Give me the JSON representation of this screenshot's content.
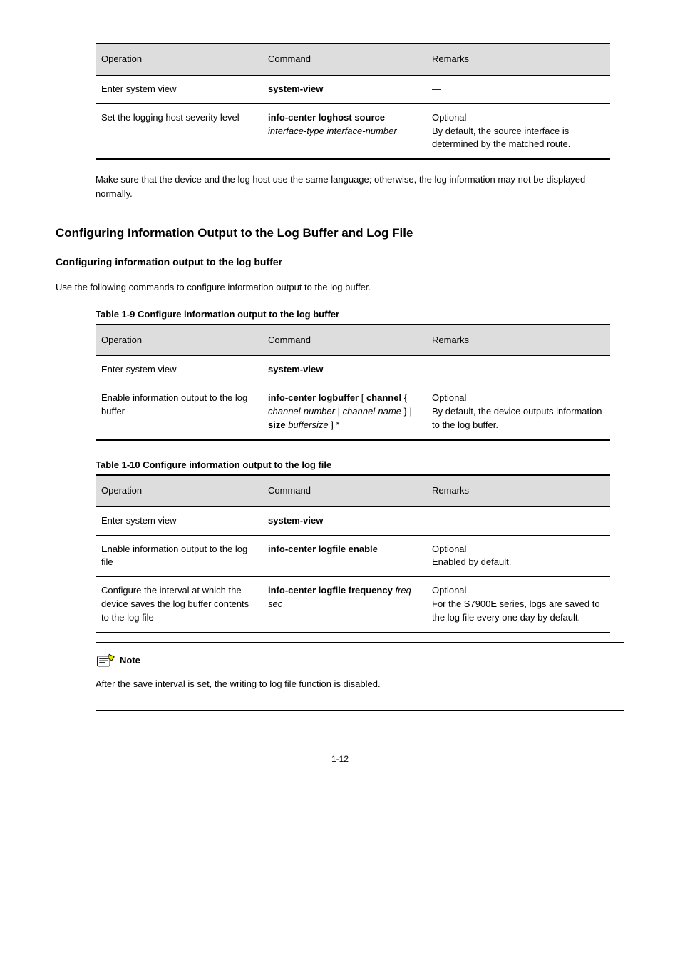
{
  "table1": {
    "header": [
      "Operation",
      "Command",
      "Remarks"
    ],
    "rows": [
      [
        "Enter system view",
        "system-view",
        "—"
      ],
      [
        "Set the logging host severity level",
        "info-center loghost source interface-type interface-number",
        "Optional\nBy default, the source interface is determined by the matched route."
      ]
    ]
  },
  "para_after_t1": "Make sure that the device and the log host use the same language; otherwise, the log information may not be displayed normally.",
  "h2": "Configuring Information Output to the Log Buffer and Log File",
  "h3_1": "Configuring information output to the log buffer",
  "para_1": "Use the following commands to configure information output to the log buffer.",
  "tcap_2": "Table 1-9 Configure information output to the log buffer",
  "table2": {
    "header": [
      "Operation",
      "Command",
      "Remarks"
    ],
    "rows": [
      [
        "Enter system view",
        "system-view",
        "—"
      ],
      [
        "Enable information output to the log buffer",
        "info-center logbuffer [ channel { channel-number | channel-name } | size buffersize ] *",
        "Optional\nBy default, the device outputs information to the log buffer."
      ]
    ]
  },
  "tcap_3": "Table 1-10 Configure information output to the log file",
  "table3": {
    "header": [
      "Operation",
      "Command",
      "Remarks"
    ],
    "rows": [
      [
        "Enter system view",
        "system-view",
        "—"
      ],
      [
        "Enable information output to the log file",
        "info-center logfile enable",
        "Optional\nEnabled by default."
      ],
      [
        "Configure the interval at which the device saves the log buffer contents to the log file",
        "info-center logfile frequency freq-sec",
        "Optional\nFor the S7900E series, logs are saved to the log file every one day by default."
      ]
    ]
  },
  "note": {
    "label": "Note",
    "text": "After the save interval is set, the writing to log file function is disabled."
  },
  "footer": "1-12"
}
